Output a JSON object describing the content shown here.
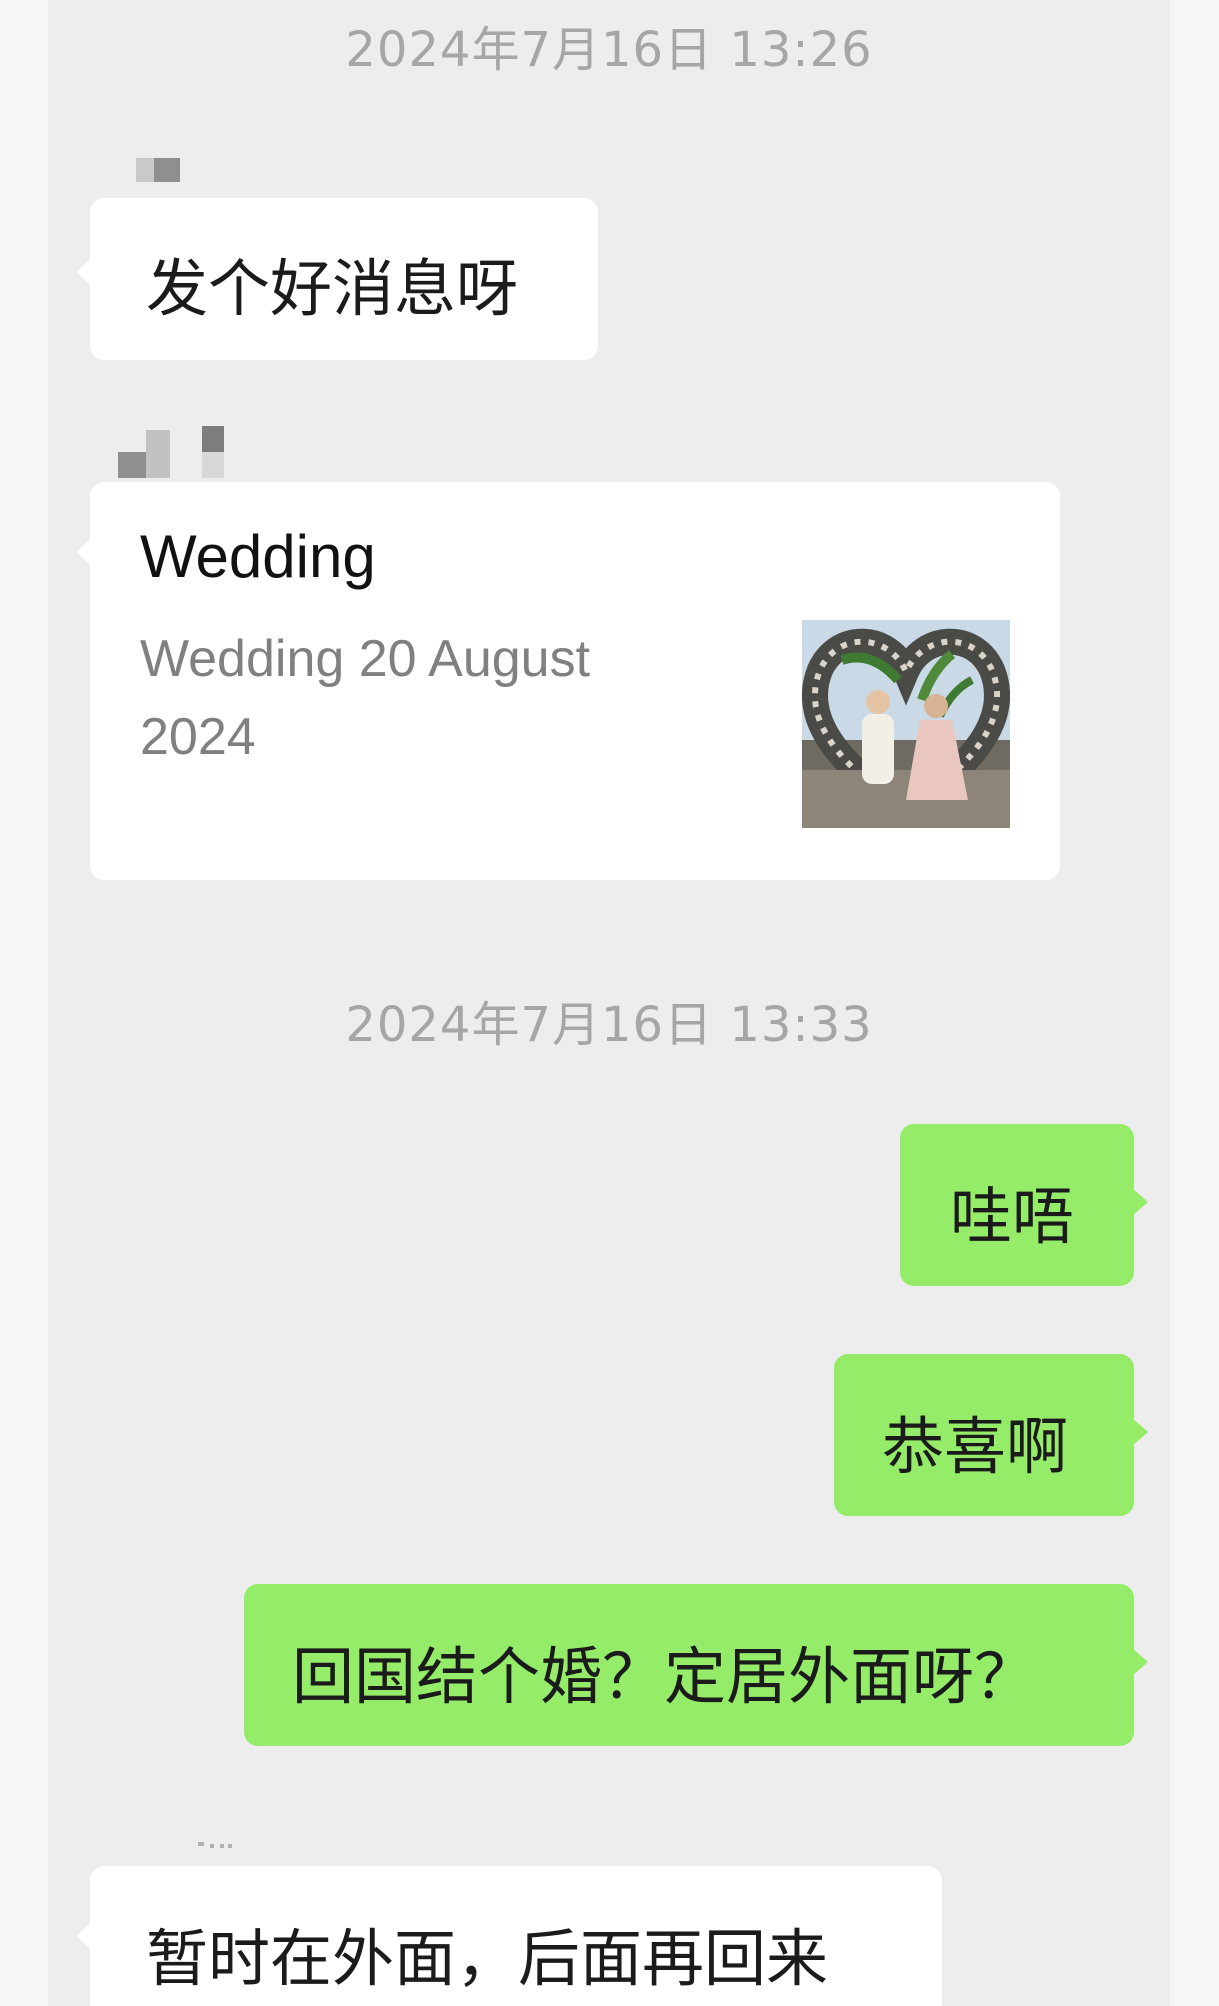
{
  "timestamps": {
    "first": "2024年7月16日 13:26",
    "second": "2024年7月16日 13:33"
  },
  "messages": {
    "m1_text": "发个好消息呀",
    "card": {
      "title": "Wedding",
      "description": "Wedding 20 August 2024",
      "thumbnail_icon": "wedding-photo-thumbnail"
    },
    "m3_text": "哇唔",
    "m4_text": "恭喜啊",
    "m5_text": "回国结个婚？定居外面呀？",
    "m6_text": "暂时在外面，后面再回来"
  },
  "colors": {
    "chat_background": "#ededed",
    "incoming_bubble": "#ffffff",
    "outgoing_bubble": "#95ec69",
    "timestamp_text": "#a6a6a6"
  }
}
